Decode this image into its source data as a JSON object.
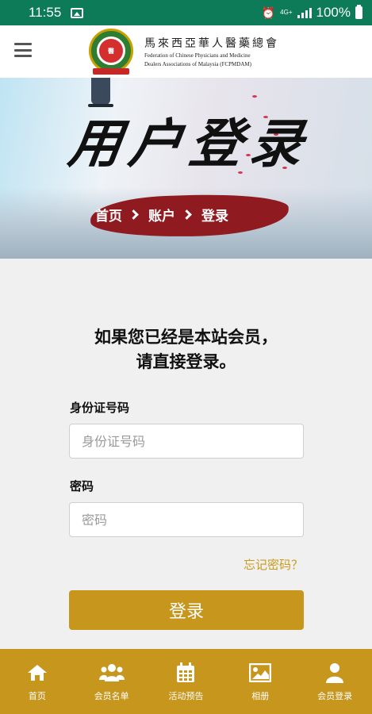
{
  "status_bar": {
    "time": "11:55",
    "network": "4G+",
    "battery": "100%"
  },
  "header": {
    "org_chinese": "馬來西亞華人醫藥總會",
    "org_english_line1": "Federation of Chinese Physicians and Medicine",
    "org_english_line2": "Dealers Associations of Malaysia (FCPMDAM)"
  },
  "banner": {
    "title": "用户登录",
    "breadcrumb": [
      "首页",
      "账户",
      "登录"
    ]
  },
  "form": {
    "heading_line1": "如果您已经是本站会员，",
    "heading_line2": "请直接登录。",
    "id_label": "身份证号码",
    "id_placeholder": "身份证号码",
    "password_label": "密码",
    "password_placeholder": "密码",
    "forgot_link": "忘记密码？",
    "submit_label": "登录"
  },
  "bottom_nav": [
    {
      "label": "首页",
      "icon": "home-icon"
    },
    {
      "label": "会员名单",
      "icon": "members-icon"
    },
    {
      "label": "活动预告",
      "icon": "calendar-icon"
    },
    {
      "label": "相册",
      "icon": "photo-icon"
    },
    {
      "label": "会员登录",
      "icon": "user-icon"
    }
  ],
  "colors": {
    "status_bar": "#0d7a58",
    "accent_gold": "#c6961d",
    "brush_red": "#8f1a1f"
  }
}
